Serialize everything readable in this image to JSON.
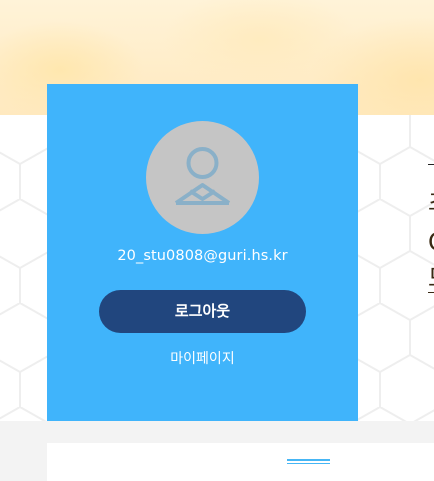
{
  "profile": {
    "email": "20_stu0808@guri.hs.kr",
    "logout_label": "로그아웃",
    "mypage_label": "마이페이지"
  },
  "right_panel": {
    "lines": [
      "초",
      "O",
      "모"
    ]
  },
  "colors": {
    "card": "#40b4fb",
    "button": "#21467e",
    "avatar_bg": "#c5c5c5",
    "avatar_icon": "#8ab0c8",
    "banner": "#ffe9bf"
  },
  "icons": {
    "avatar": "user-silhouette-icon"
  }
}
